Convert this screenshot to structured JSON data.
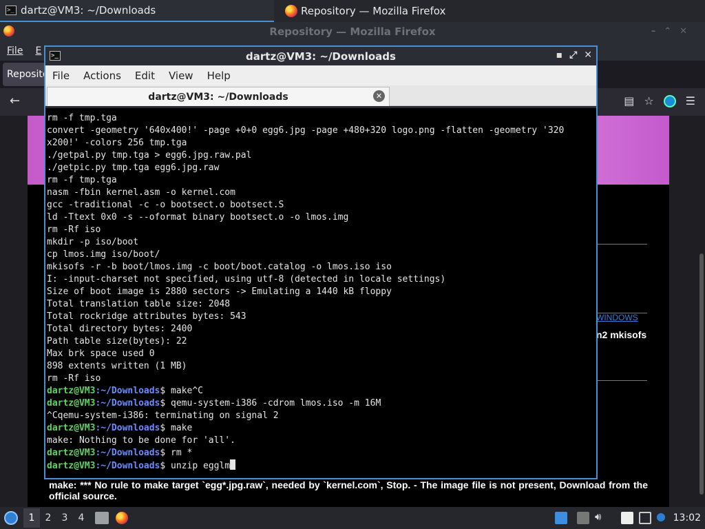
{
  "taskbar": {
    "tasks": [
      {
        "label": "dartz@VM3: ~/Downloads"
      },
      {
        "label": "Repository — Mozilla Firefox"
      }
    ]
  },
  "firefox": {
    "title": "Repository — Mozilla Firefox",
    "menu": [
      "File",
      "E"
    ],
    "tab_label": "Reposito",
    "page": {
      "link_fragment": "WINDOWS",
      "mkisofs_fragment": "n2 mkisofs",
      "bottom_text": "make: *** No rule to make target `egg*.jpg.raw`, needed by `kernel.com`, Stop. - The image file is not present, Download from the official source."
    }
  },
  "terminal": {
    "title": "dartz@VM3: ~/Downloads",
    "menu": [
      "File",
      "Actions",
      "Edit",
      "View",
      "Help"
    ],
    "tab_label": "dartz@VM3: ~/Downloads",
    "prompt_user": "dartz@VM3",
    "prompt_path": ":~/Downloads",
    "lines": [
      {
        "text": "rm -f tmp.tga"
      },
      {
        "text": "convert -geometry '640x400!' -page +0+0 egg6.jpg -page +480+320 logo.png -flatten -geometry '320"
      },
      {
        "text": "x200!' -colors 256 tmp.tga"
      },
      {
        "text": "./getpal.py tmp.tga > egg6.jpg.raw.pal"
      },
      {
        "text": "./getpic.py tmp.tga egg6.jpg.raw"
      },
      {
        "text": "rm -f tmp.tga"
      },
      {
        "text": "nasm -fbin kernel.asm -o kernel.com"
      },
      {
        "text": "gcc -traditional -c -o bootsect.o bootsect.S"
      },
      {
        "text": "ld -Ttext 0x0 -s --oformat binary bootsect.o -o lmos.img"
      },
      {
        "text": "rm -Rf iso"
      },
      {
        "text": "mkdir -p iso/boot"
      },
      {
        "text": "cp lmos.img iso/boot/"
      },
      {
        "text": "mkisofs -r -b boot/lmos.img -c boot/boot.catalog -o lmos.iso iso"
      },
      {
        "text": "I: -input-charset not specified, using utf-8 (detected in locale settings)"
      },
      {
        "text": "Size of boot image is 2880 sectors -> Emulating a 1440 kB floppy"
      },
      {
        "text": "Total translation table size: 2048"
      },
      {
        "text": "Total rockridge attributes bytes: 543"
      },
      {
        "text": "Total directory bytes: 2400"
      },
      {
        "text": "Path table size(bytes): 22"
      },
      {
        "text": "Max brk space used 0"
      },
      {
        "text": "898 extents written (1 MB)"
      },
      {
        "text": "rm -Rf iso"
      },
      {
        "prompt": true,
        "text": "$ make^C"
      },
      {
        "prompt": true,
        "text": "$ qemu-system-i386 -cdrom lmos.iso -m 16M"
      },
      {
        "text": "^Cqemu-system-i386: terminating on signal 2"
      },
      {
        "prompt": true,
        "text": "$ make"
      },
      {
        "text": "make: Nothing to be done for 'all'."
      },
      {
        "prompt": true,
        "text": "$ rm *"
      },
      {
        "prompt": true,
        "text": "$ unzip egglm",
        "cursor": true
      }
    ]
  },
  "panel": {
    "workspaces": [
      "1",
      "2",
      "3",
      "4"
    ],
    "active_workspace": "1",
    "clock": "13:02"
  }
}
